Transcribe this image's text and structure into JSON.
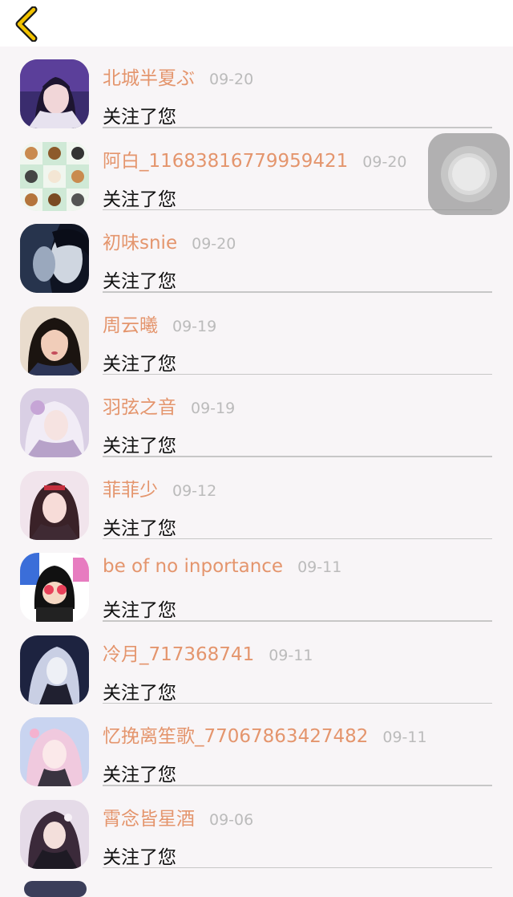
{
  "header": {
    "back_icon": "chevron-left-icon",
    "accent_color": "#f2c300"
  },
  "notifications": [
    {
      "name": "北城半夏ぶ",
      "date": "09-20",
      "message": "关注了您"
    },
    {
      "name": "阿白_1168381677995942​1",
      "date": "09-20",
      "message": "关注了您"
    },
    {
      "name": "初味snie",
      "date": "09-20",
      "message": "关注了您"
    },
    {
      "name": "周云曦",
      "date": "09-19",
      "message": "关注了您"
    },
    {
      "name": "羽弦之音",
      "date": "09-19",
      "message": "关注了您"
    },
    {
      "name": "菲菲少",
      "date": "09-12",
      "message": "关注了您"
    },
    {
      "name": "be of no inportance",
      "date": "09-11",
      "message": "关注了您"
    },
    {
      "name": "冷月_717368741",
      "date": "09-11",
      "message": "关注了您"
    },
    {
      "name": "忆挽离笙歌_77067863427482",
      "date": "09-11",
      "message": "关注了您"
    },
    {
      "name": "霄念皆星酒",
      "date": "09-06",
      "message": "关注了您"
    }
  ],
  "colors": {
    "name": "#e4956d",
    "date": "#bbbbbb",
    "message": "#111111",
    "background": "#f8f5f7"
  }
}
